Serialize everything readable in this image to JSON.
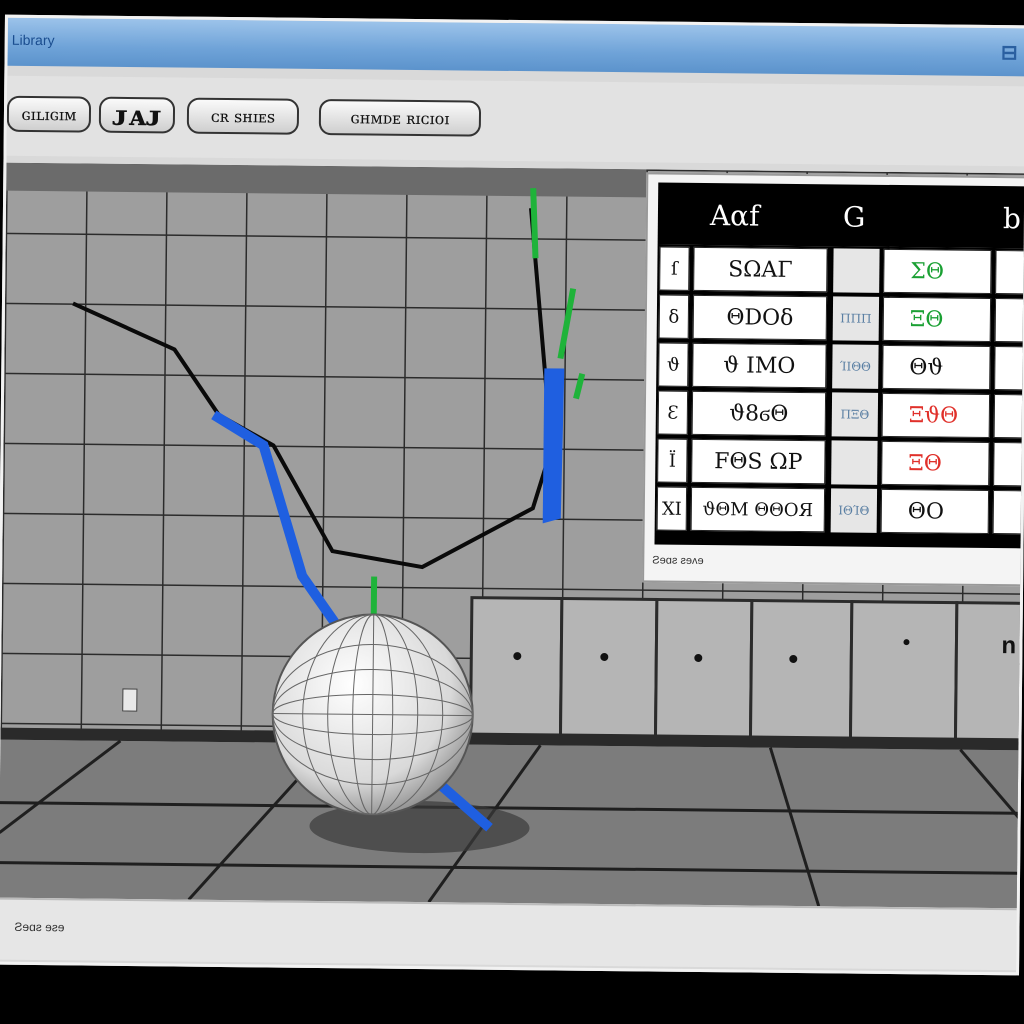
{
  "window": {
    "title": "Library"
  },
  "toolbar": {
    "buttons": [
      {
        "label": "ɢɪʟɪɢɪᴍ"
      },
      {
        "label": "ᴊᴀᴊ"
      },
      {
        "label": "ᴄʀ ꜱʜɪᴇꜱ"
      },
      {
        "label": "ɢʜᴍᴅᴇ ʀɪᴄɪᴏɪ"
      }
    ]
  },
  "table": {
    "headers": [
      "Aαf",
      "G",
      "b"
    ],
    "rows": [
      {
        "index": "ſ",
        "name": "SΩΑΓ",
        "mid": "",
        "value": "ΣΘ",
        "value_color": "#1aa033"
      },
      {
        "index": "δ",
        "name": "ΘDOδ",
        "mid": "ΠΠΠ",
        "value": "ΞΘ",
        "value_color": "#1aa033"
      },
      {
        "index": "ϑ",
        "name": "ϑ ΙΜΟ",
        "mid": "ΊΙΘΘ",
        "value": "Θϑ",
        "value_color": "#111111"
      },
      {
        "index": "Ɛ",
        "name": "ϑ8ϭΘ",
        "mid": "ΠΞΘ",
        "value": "ΞϑΘ",
        "value_color": "#e0302a"
      },
      {
        "index": "Ϊ",
        "name": "FΘS ΩΡ",
        "mid": "",
        "value": "ΞΘ",
        "value_color": "#e0302a"
      },
      {
        "index": "ΧΙ",
        "name": "ϑΘΜ ΘΘΟЯ",
        "mid": "ΙΘΊΘ",
        "value": "ΘΟ",
        "value_color": "#111111"
      }
    ],
    "footer": "Ƨɘɑƨ ƨɘʌɘ"
  },
  "status": {
    "text": "Ƨɘɑƨ ɘƨɘ"
  }
}
